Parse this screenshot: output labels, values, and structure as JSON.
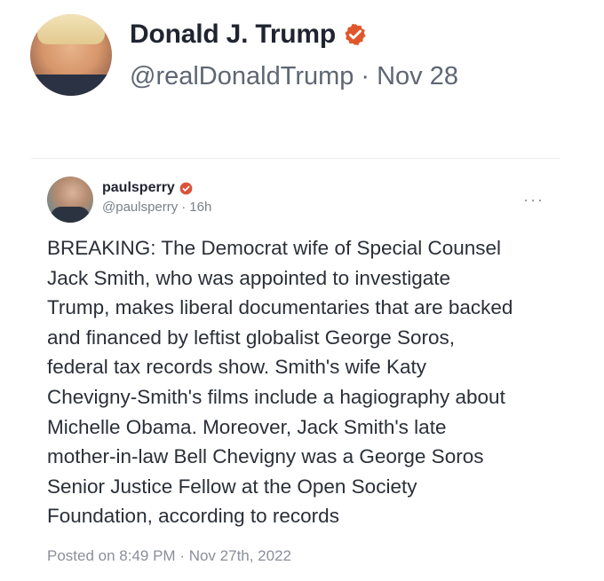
{
  "post": {
    "author_name": "Donald J. Trump",
    "author_handle": "@realDonaldTrump",
    "separator": "·",
    "date": "Nov 28",
    "verified_icon": "verified-badge-icon",
    "accent_color": "#e0572b"
  },
  "quoted": {
    "author_name": "paulsperry",
    "author_handle": "@paulsperry",
    "separator": "·",
    "age": "16h",
    "more_label": "···",
    "lines": [
      "BREAKING: The Democrat wife of Special Counsel",
      "Jack Smith, who was appointed to investigate",
      "Trump, makes liberal documentaries that are backed",
      "and financed by leftist globalist George Soros,",
      "federal tax records show. Smith's wife Katy",
      "Chevigny-Smith's films include a hagiography about",
      "Michelle Obama. Moreover, Jack Smith's late",
      "mother-in-law Bell Chevigny was a George Soros",
      "Senior Justice Fellow at the Open Society",
      "Foundation, according to records"
    ],
    "posted_text": "Posted on 8:49 PM · Nov 27th, 2022"
  }
}
